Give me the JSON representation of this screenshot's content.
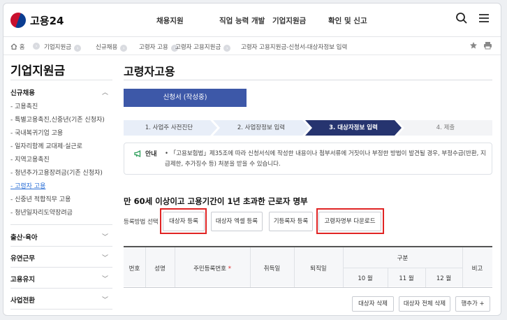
{
  "header": {
    "logo_text": "고용24",
    "nav": [
      "채용지원",
      "직업 능력 개발",
      "기업지원금",
      "확인 및 신고"
    ]
  },
  "breadcrumb": {
    "home": "홈",
    "items": [
      "기업지원금",
      "신규채용",
      "고령자 고용",
      "고령자 고용지원금",
      "고령자 고용지원금-신청서-대상자정보 입력"
    ]
  },
  "sidebar": {
    "title": "기업지원금",
    "groups": [
      "신규채용",
      "출산·육아",
      "유연근무",
      "고용유지",
      "사업전환"
    ],
    "items": [
      "- 고용촉진",
      "- 특별고용촉진,신중년(기존 신청자)",
      "- 국내복귀기업 고용",
      "- 일자리함께 교대제·실근로",
      "- 지역고용촉진",
      "- 청년추가고용장려금(기존 신청자)",
      "- 고령자 고용",
      "- 신중년 적합직무 고용",
      "- 청년일자리도약장려금"
    ]
  },
  "main": {
    "title": "고령자고용",
    "apply_button": "신청서 (작성중)",
    "steps": [
      "1. 사업주 사전진단",
      "2. 사업장정보 입력",
      "3. 대상자정보 입력",
      "4. 제출"
    ],
    "notice_label": "안내",
    "notice_text": "• 「고용보험법」제35조에 따라 신청서식에 작성한 내용이나 첨부서류에 거짓이나 부정한 방법이 발견될 경우, 부정수급(반환, 지급제한, 추가징수 등) 처분을 받을 수 있습니다.",
    "section_title": "만 60세 이상이고 고용기간이 1년 초과한 근로자 명부",
    "reg_label": "등록방법 선택",
    "reg_buttons": [
      "대상자 등록",
      "대상자 엑셀 등록",
      "기등록자 등록",
      "고령자명부 다운로드"
    ],
    "table": {
      "headers": [
        "번호",
        "성명",
        "주민등록번호",
        "취득일",
        "퇴직일",
        "구분",
        "비고"
      ],
      "required_mark": "*",
      "months": [
        "10 월",
        "11 월",
        "12 월"
      ]
    },
    "bottom_buttons": [
      "대상자 삭제",
      "대상자 전체 삭제",
      "행추가 +"
    ]
  },
  "colors": {
    "primary": "#3d58a8",
    "active_step": "#26346f",
    "highlight": "#e02424",
    "link": "#2b6fd6"
  }
}
